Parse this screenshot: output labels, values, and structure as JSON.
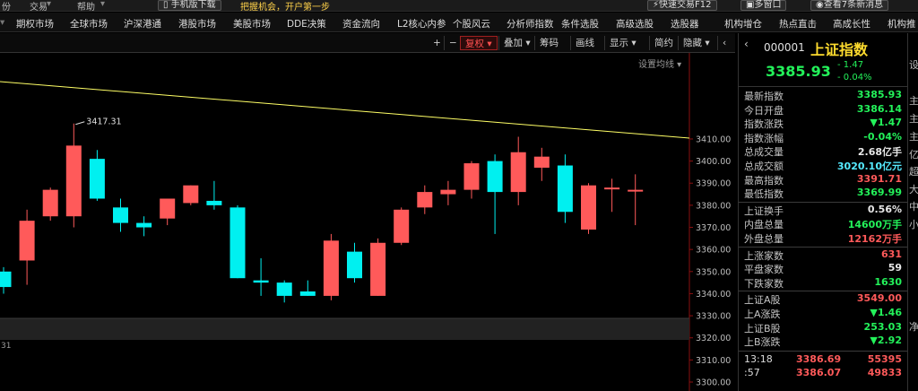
{
  "topbar": {
    "items": [
      "份",
      "交易",
      "帮助"
    ],
    "mobile_button": "手机版下载",
    "promo": "把握机会，开户第一步",
    "quick_trade": "快速交易F12",
    "multi_window": "多窗口",
    "news": "查看7条新消息"
  },
  "menu": [
    "期权市场",
    "全球市场",
    "沪深港通",
    "港股市场",
    "美股市场",
    "DDE决策",
    "资金流向",
    "L2核心内参",
    "个股风云",
    "分析师指数",
    "条件选股",
    "高级选股",
    "选股器",
    "机构增仓",
    "热点直击",
    "高成长性",
    "机构推"
  ],
  "chart": {
    "toolbar": [
      "+",
      "−",
      "复权",
      "叠加",
      "筹码",
      "画线",
      "显示",
      "简约",
      "隐藏"
    ],
    "active_toolbar": "复权",
    "indicator_setting": "设置均线",
    "peak_label": "3417.31",
    "left_edge_label": "31",
    "colors": {
      "up": "#ff5a5a",
      "down": "#00f0f0",
      "trend": "#ffff66"
    },
    "chart_data": {
      "type": "candlestick",
      "ylim": [
        3300,
        3425
      ],
      "yticks": [
        "3410.00",
        "3400.00",
        "3390.00",
        "3380.00",
        "3370.00",
        "3360.00",
        "3350.00",
        "3340.00",
        "3330.00",
        "3320.00",
        "3310.00",
        "3300.00"
      ],
      "candles": [
        {
          "o": 3350,
          "h": 3352,
          "l": 3340,
          "c": 3343
        },
        {
          "o": 3355,
          "h": 3378,
          "l": 3344,
          "c": 3373
        },
        {
          "o": 3375,
          "h": 3388,
          "l": 3373,
          "c": 3387
        },
        {
          "o": 3375,
          "h": 3417,
          "l": 3370,
          "c": 3407
        },
        {
          "o": 3401,
          "h": 3405,
          "l": 3382,
          "c": 3383
        },
        {
          "o": 3379,
          "h": 3383,
          "l": 3368,
          "c": 3372
        },
        {
          "o": 3372,
          "h": 3375,
          "l": 3366,
          "c": 3370
        },
        {
          "o": 3374,
          "h": 3382,
          "l": 3371,
          "c": 3383
        },
        {
          "o": 3381,
          "h": 3389,
          "l": 3380,
          "c": 3389
        },
        {
          "o": 3382,
          "h": 3391,
          "l": 3378,
          "c": 3380
        },
        {
          "o": 3379,
          "h": 3380,
          "l": 3347,
          "c": 3347
        },
        {
          "o": 3346,
          "h": 3356,
          "l": 3339,
          "c": 3345
        },
        {
          "o": 3345,
          "h": 3346,
          "l": 3336,
          "c": 3339
        },
        {
          "o": 3341,
          "h": 3346,
          "l": 3339,
          "c": 3339
        },
        {
          "o": 3339,
          "h": 3367,
          "l": 3337,
          "c": 3364
        },
        {
          "o": 3359,
          "h": 3363,
          "l": 3345,
          "c": 3347
        },
        {
          "o": 3339,
          "h": 3365,
          "l": 3339,
          "c": 3363
        },
        {
          "o": 3363,
          "h": 3379,
          "l": 3362,
          "c": 3378
        },
        {
          "o": 3379,
          "h": 3389,
          "l": 3376,
          "c": 3386
        },
        {
          "o": 3385,
          "h": 3391,
          "l": 3380,
          "c": 3387
        },
        {
          "o": 3387,
          "h": 3400,
          "l": 3383,
          "c": 3399
        },
        {
          "o": 3400,
          "h": 3403,
          "l": 3367,
          "c": 3386
        },
        {
          "o": 3386,
          "h": 3411,
          "l": 3380,
          "c": 3404
        },
        {
          "o": 3397,
          "h": 3406,
          "l": 3391,
          "c": 3402
        },
        {
          "o": 3398,
          "h": 3403,
          "l": 3372,
          "c": 3377
        },
        {
          "o": 3369,
          "h": 3390,
          "l": 3367,
          "c": 3389
        },
        {
          "o": 3388,
          "h": 3392,
          "l": 3377,
          "c": 3388
        },
        {
          "o": 3387,
          "h": 3394,
          "l": 3371,
          "c": 3387
        }
      ]
    }
  },
  "quote": {
    "code": "000001",
    "name": "上证指数",
    "price": "3385.93",
    "change": "- 1.47",
    "change_pct": "- 0.04%",
    "rows": [
      {
        "label": "最新指数",
        "value": "3385.93",
        "color": "#23f25a"
      },
      {
        "label": "今日开盘",
        "value": "3386.14",
        "color": "#23f25a"
      },
      {
        "label": "指数涨跌",
        "value": "▼1.47",
        "color": "#23f25a"
      },
      {
        "label": "指数涨幅",
        "value": "-0.04%",
        "color": "#23f25a"
      },
      {
        "label": "总成交量",
        "value": "2.68亿手",
        "color": "#e8e8e8"
      },
      {
        "label": "总成交额",
        "value": "3020.10亿元",
        "color": "#55eaff"
      },
      {
        "label": "最高指数",
        "value": "3391.71",
        "color": "#ff5a5a"
      },
      {
        "label": "最低指数",
        "value": "3369.99",
        "color": "#23f25a"
      },
      {
        "label": "上证换手",
        "value": "0.56%",
        "color": "#e8e8e8"
      },
      {
        "label": "内盘总量",
        "value": "14600万手",
        "color": "#23f25a"
      },
      {
        "label": "外盘总量",
        "value": "12162万手",
        "color": "#ff5a5a"
      },
      {
        "label": "上涨家数",
        "value": "631",
        "color": "#ff5a5a"
      },
      {
        "label": "平盘家数",
        "value": "59",
        "color": "#e8e8e8"
      },
      {
        "label": "下跌家数",
        "value": "1630",
        "color": "#23f25a"
      },
      {
        "label": "上证A股",
        "value": "3549.00",
        "color": "#ff5a5a"
      },
      {
        "label": "上A涨跌",
        "value": "▼1.46",
        "color": "#23f25a"
      },
      {
        "label": "上证B股",
        "value": "253.03",
        "color": "#23f25a"
      },
      {
        "label": "上B涨跌",
        "value": "▼2.92",
        "color": "#23f25a"
      }
    ],
    "ticks": [
      {
        "time": "13:18",
        "price": "3386.69",
        "vol": "55395"
      },
      {
        "time": ":57",
        "price": "3386.07",
        "vol": "49833"
      }
    ]
  },
  "right_strip": [
    "设",
    "主",
    "主",
    "主",
    "亿",
    "超",
    "大",
    "中",
    "小",
    "净"
  ]
}
